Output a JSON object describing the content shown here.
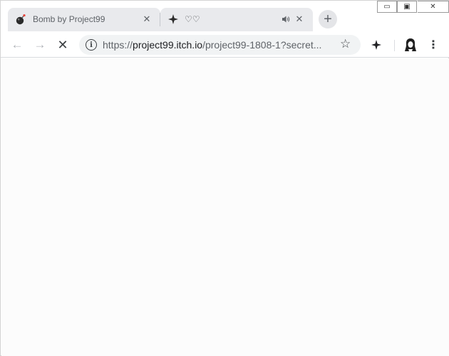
{
  "tabs": [
    {
      "title": "Bomb by Project99",
      "favicon": "bomb-icon",
      "active": false
    },
    {
      "title": "♡♡",
      "favicon": "sparkle-icon",
      "active": false,
      "audio": true
    }
  ],
  "new_tab_label": "+",
  "window_controls": {
    "minimize": "▭",
    "maximize": "▣",
    "close": "✕"
  },
  "toolbar": {
    "back": "←",
    "forward": "→",
    "stop": "✕",
    "url_scheme": "https://",
    "url_host": "project99.itch.io",
    "url_path": "/project99-1808-1?secret...",
    "info": "i",
    "bookmark": "☆",
    "extension": "sparkle-icon",
    "menu": "⋮"
  },
  "colors": {
    "tab_bg": "#e9eaed",
    "omnibox_bg": "#f1f3f4",
    "page_bg": "#fcfcfc"
  }
}
